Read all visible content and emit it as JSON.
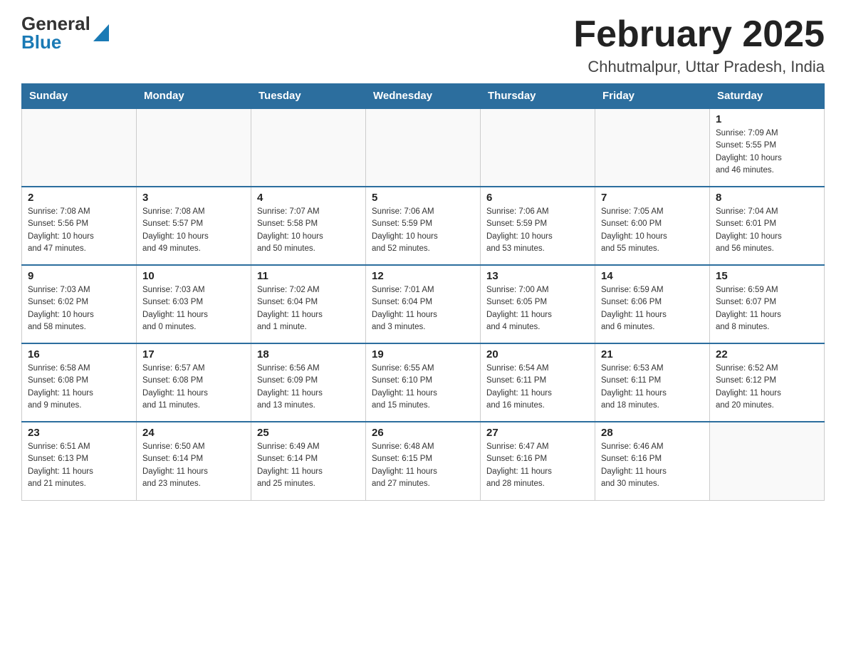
{
  "header": {
    "logo_general": "General",
    "logo_blue": "Blue",
    "month_title": "February 2025",
    "location": "Chhutmalpur, Uttar Pradesh, India"
  },
  "weekdays": [
    "Sunday",
    "Monday",
    "Tuesday",
    "Wednesday",
    "Thursday",
    "Friday",
    "Saturday"
  ],
  "weeks": [
    [
      {
        "day": "",
        "info": ""
      },
      {
        "day": "",
        "info": ""
      },
      {
        "day": "",
        "info": ""
      },
      {
        "day": "",
        "info": ""
      },
      {
        "day": "",
        "info": ""
      },
      {
        "day": "",
        "info": ""
      },
      {
        "day": "1",
        "info": "Sunrise: 7:09 AM\nSunset: 5:55 PM\nDaylight: 10 hours\nand 46 minutes."
      }
    ],
    [
      {
        "day": "2",
        "info": "Sunrise: 7:08 AM\nSunset: 5:56 PM\nDaylight: 10 hours\nand 47 minutes."
      },
      {
        "day": "3",
        "info": "Sunrise: 7:08 AM\nSunset: 5:57 PM\nDaylight: 10 hours\nand 49 minutes."
      },
      {
        "day": "4",
        "info": "Sunrise: 7:07 AM\nSunset: 5:58 PM\nDaylight: 10 hours\nand 50 minutes."
      },
      {
        "day": "5",
        "info": "Sunrise: 7:06 AM\nSunset: 5:59 PM\nDaylight: 10 hours\nand 52 minutes."
      },
      {
        "day": "6",
        "info": "Sunrise: 7:06 AM\nSunset: 5:59 PM\nDaylight: 10 hours\nand 53 minutes."
      },
      {
        "day": "7",
        "info": "Sunrise: 7:05 AM\nSunset: 6:00 PM\nDaylight: 10 hours\nand 55 minutes."
      },
      {
        "day": "8",
        "info": "Sunrise: 7:04 AM\nSunset: 6:01 PM\nDaylight: 10 hours\nand 56 minutes."
      }
    ],
    [
      {
        "day": "9",
        "info": "Sunrise: 7:03 AM\nSunset: 6:02 PM\nDaylight: 10 hours\nand 58 minutes."
      },
      {
        "day": "10",
        "info": "Sunrise: 7:03 AM\nSunset: 6:03 PM\nDaylight: 11 hours\nand 0 minutes."
      },
      {
        "day": "11",
        "info": "Sunrise: 7:02 AM\nSunset: 6:04 PM\nDaylight: 11 hours\nand 1 minute."
      },
      {
        "day": "12",
        "info": "Sunrise: 7:01 AM\nSunset: 6:04 PM\nDaylight: 11 hours\nand 3 minutes."
      },
      {
        "day": "13",
        "info": "Sunrise: 7:00 AM\nSunset: 6:05 PM\nDaylight: 11 hours\nand 4 minutes."
      },
      {
        "day": "14",
        "info": "Sunrise: 6:59 AM\nSunset: 6:06 PM\nDaylight: 11 hours\nand 6 minutes."
      },
      {
        "day": "15",
        "info": "Sunrise: 6:59 AM\nSunset: 6:07 PM\nDaylight: 11 hours\nand 8 minutes."
      }
    ],
    [
      {
        "day": "16",
        "info": "Sunrise: 6:58 AM\nSunset: 6:08 PM\nDaylight: 11 hours\nand 9 minutes."
      },
      {
        "day": "17",
        "info": "Sunrise: 6:57 AM\nSunset: 6:08 PM\nDaylight: 11 hours\nand 11 minutes."
      },
      {
        "day": "18",
        "info": "Sunrise: 6:56 AM\nSunset: 6:09 PM\nDaylight: 11 hours\nand 13 minutes."
      },
      {
        "day": "19",
        "info": "Sunrise: 6:55 AM\nSunset: 6:10 PM\nDaylight: 11 hours\nand 15 minutes."
      },
      {
        "day": "20",
        "info": "Sunrise: 6:54 AM\nSunset: 6:11 PM\nDaylight: 11 hours\nand 16 minutes."
      },
      {
        "day": "21",
        "info": "Sunrise: 6:53 AM\nSunset: 6:11 PM\nDaylight: 11 hours\nand 18 minutes."
      },
      {
        "day": "22",
        "info": "Sunrise: 6:52 AM\nSunset: 6:12 PM\nDaylight: 11 hours\nand 20 minutes."
      }
    ],
    [
      {
        "day": "23",
        "info": "Sunrise: 6:51 AM\nSunset: 6:13 PM\nDaylight: 11 hours\nand 21 minutes."
      },
      {
        "day": "24",
        "info": "Sunrise: 6:50 AM\nSunset: 6:14 PM\nDaylight: 11 hours\nand 23 minutes."
      },
      {
        "day": "25",
        "info": "Sunrise: 6:49 AM\nSunset: 6:14 PM\nDaylight: 11 hours\nand 25 minutes."
      },
      {
        "day": "26",
        "info": "Sunrise: 6:48 AM\nSunset: 6:15 PM\nDaylight: 11 hours\nand 27 minutes."
      },
      {
        "day": "27",
        "info": "Sunrise: 6:47 AM\nSunset: 6:16 PM\nDaylight: 11 hours\nand 28 minutes."
      },
      {
        "day": "28",
        "info": "Sunrise: 6:46 AM\nSunset: 6:16 PM\nDaylight: 11 hours\nand 30 minutes."
      },
      {
        "day": "",
        "info": ""
      }
    ]
  ]
}
